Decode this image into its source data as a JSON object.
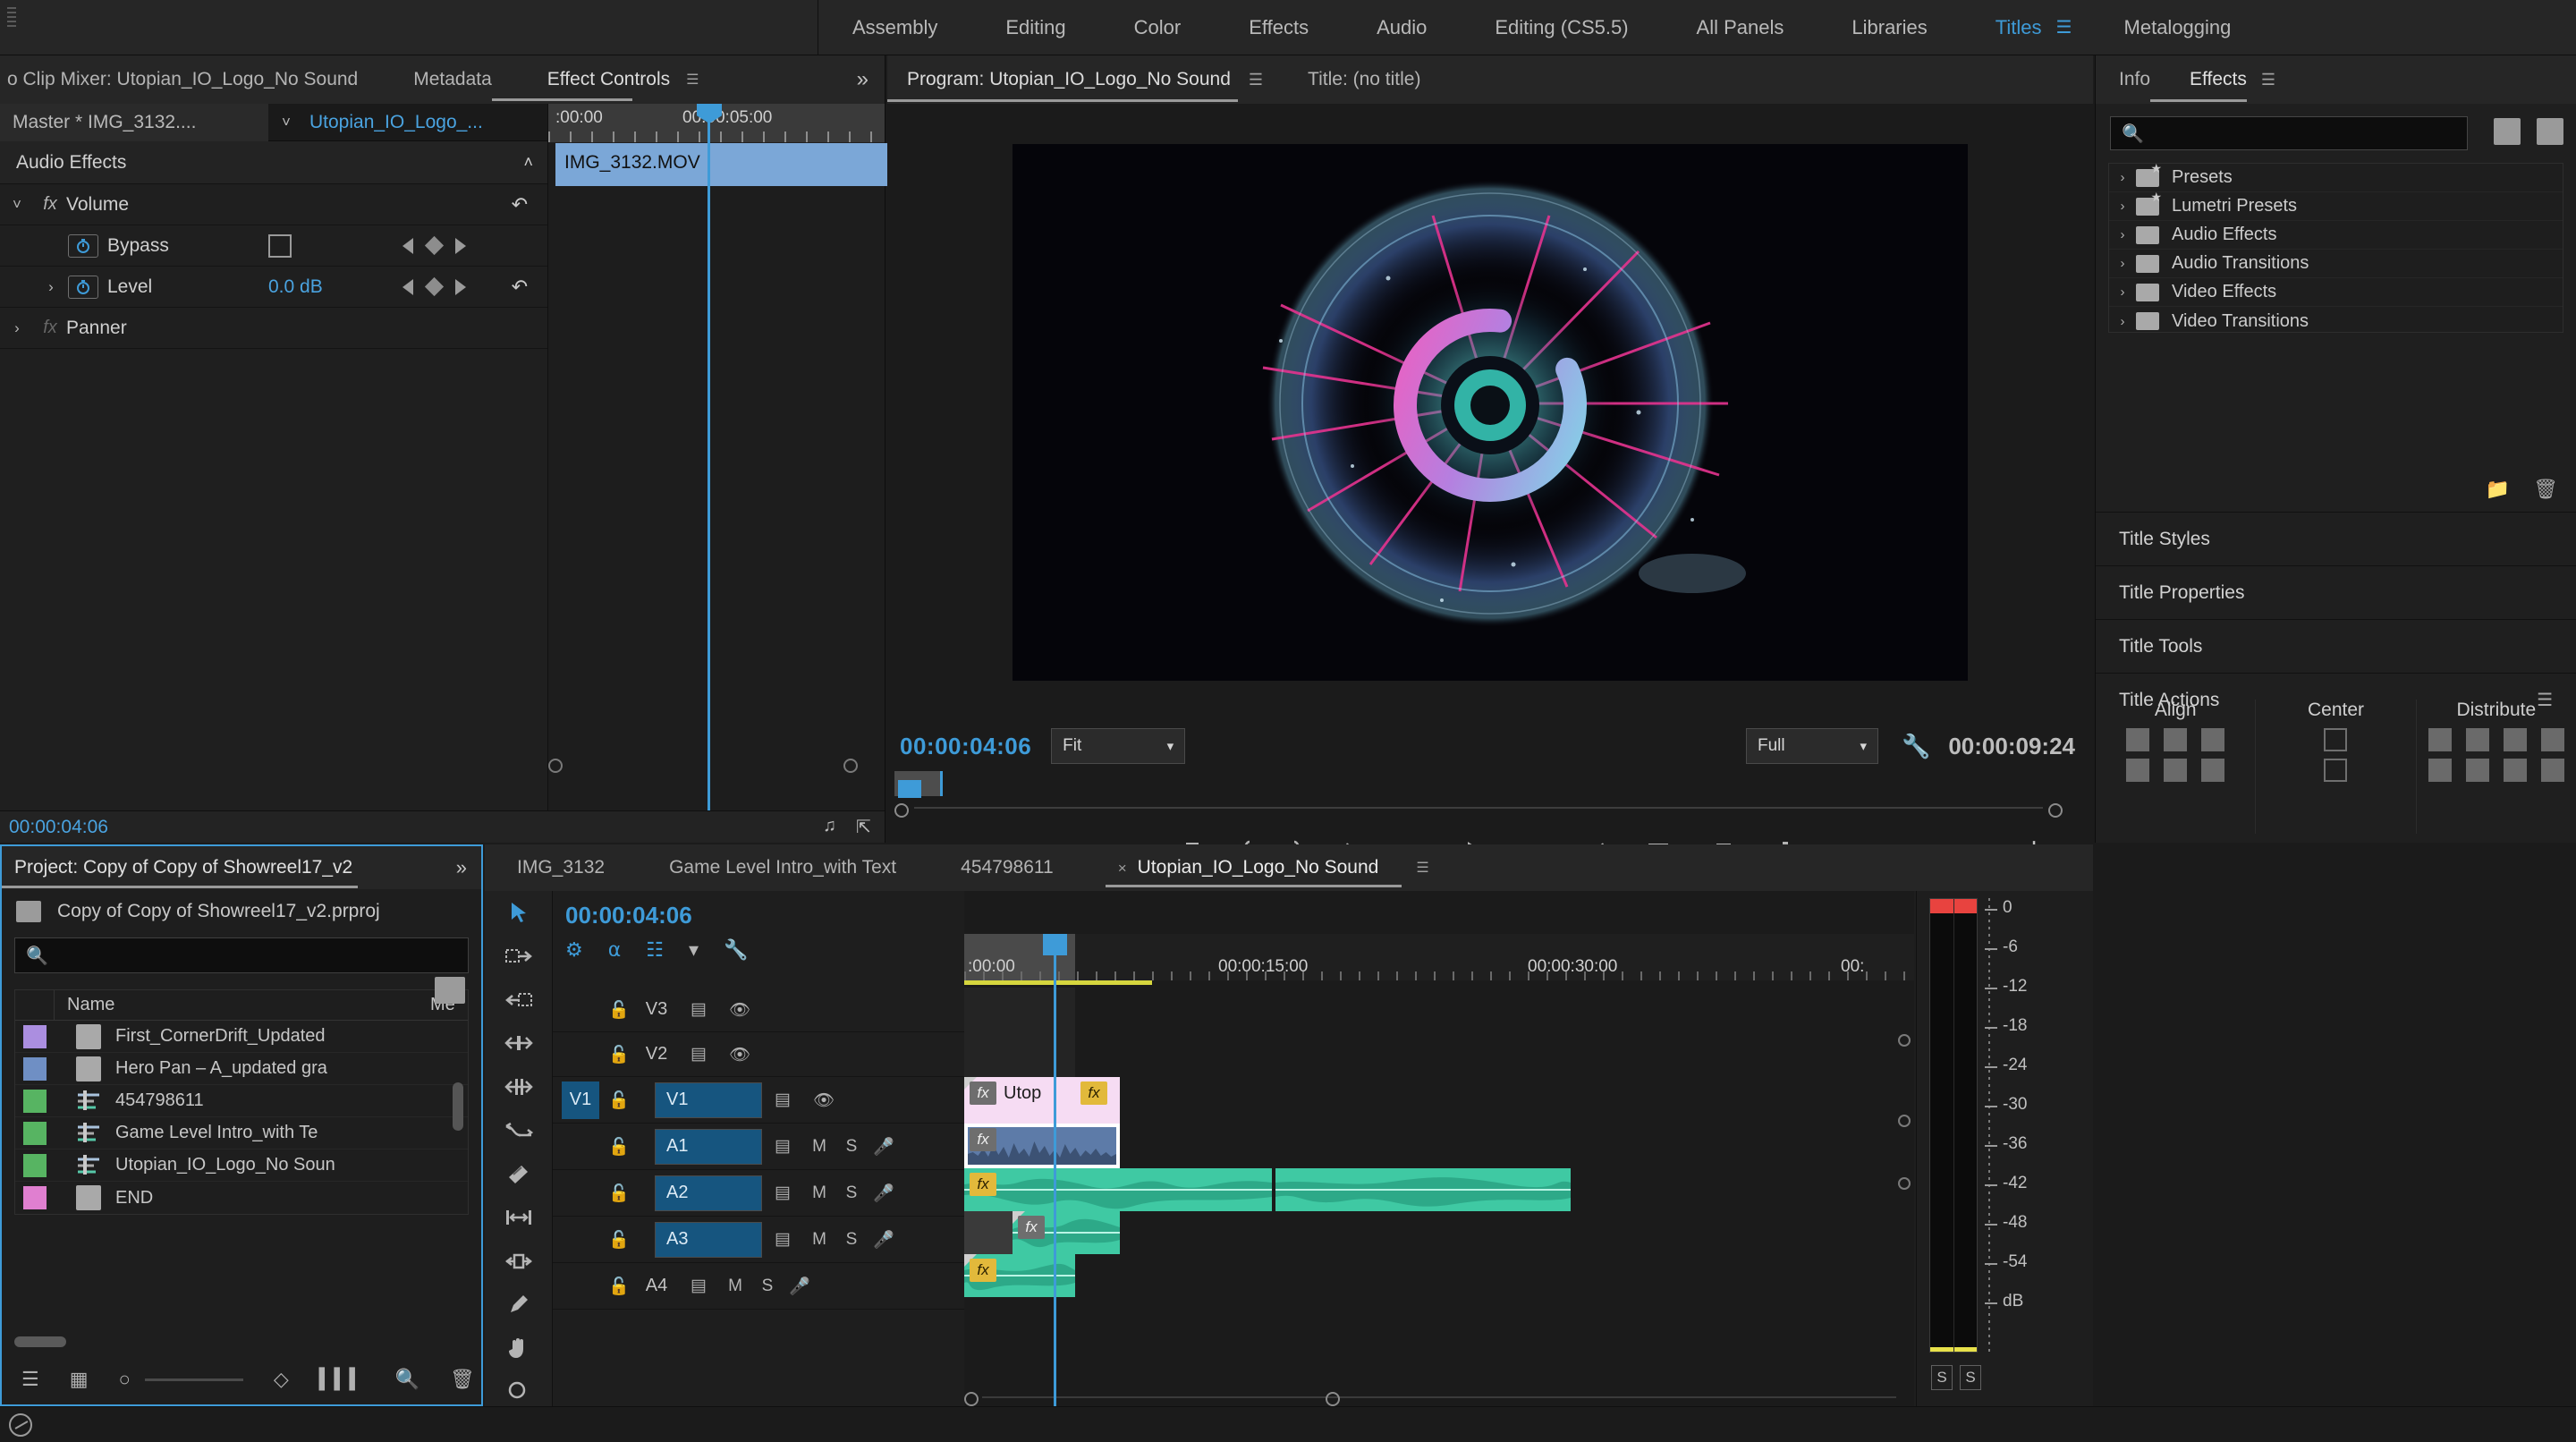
{
  "workspace": {
    "tabs": [
      {
        "label": "Assembly",
        "active": false
      },
      {
        "label": "Editing",
        "active": false
      },
      {
        "label": "Color",
        "active": false
      },
      {
        "label": "Effects",
        "active": false
      },
      {
        "label": "Audio",
        "active": false
      },
      {
        "label": "Editing (CS5.5)",
        "active": false
      },
      {
        "label": "All Panels",
        "active": false
      },
      {
        "label": "Libraries",
        "active": false
      },
      {
        "label": "Titles",
        "active": true
      },
      {
        "label": "Metalogging",
        "active": false
      }
    ]
  },
  "effect_controls": {
    "tab_clip_mixer": "o Clip Mixer: Utopian_IO_Logo_No Sound",
    "tab_metadata": "Metadata",
    "tab_effect_controls": "Effect Controls",
    "master_clip": "Master * IMG_3132....",
    "sequence_name": "Utopian_IO_Logo_...",
    "section_title": "Audio Effects",
    "properties": [
      {
        "name": "Volume",
        "type": "effect",
        "fx": "fx",
        "expanded": true,
        "has_reset": true
      },
      {
        "name": "Bypass",
        "type": "checkbox",
        "value": "",
        "checked": false,
        "has_stopwatch": true
      },
      {
        "name": "Level",
        "type": "value",
        "value": "0.0 dB",
        "has_stopwatch": true,
        "has_reset": true
      },
      {
        "name": "Panner",
        "type": "effect",
        "fx": "fx",
        "expanded": false,
        "dim": true
      }
    ],
    "ruler_labels": [
      ":00:00",
      "00:00:05:00"
    ],
    "clip_name": "IMG_3132.MOV",
    "footer_time": "00:00:04:06"
  },
  "program_monitor": {
    "title": "Program: Utopian_IO_Logo_No Sound",
    "title_tab": "Title: (no title)",
    "current_time": "00:00:04:06",
    "duration": "00:00:09:24",
    "fit_value": "Fit",
    "quality_value": "Full",
    "transport_buttons": [
      "add-marker",
      "mark-in",
      "mark-out",
      "go-to-in",
      "step-back",
      "play",
      "step-forward",
      "go-to-out",
      "lift",
      "extract",
      "export-frame"
    ]
  },
  "right_panel": {
    "tab_info": "Info",
    "tab_effects": "Effects",
    "search_placeholder": "",
    "search_value": "",
    "tree": [
      {
        "label": "Presets",
        "star": true
      },
      {
        "label": "Lumetri Presets",
        "star": true
      },
      {
        "label": "Audio Effects",
        "star": false
      },
      {
        "label": "Audio Transitions",
        "star": false
      },
      {
        "label": "Video Effects",
        "star": false
      },
      {
        "label": "Video Transitions",
        "star": false
      }
    ],
    "sections": [
      {
        "label": "Title Styles"
      },
      {
        "label": "Title Properties"
      },
      {
        "label": "Title Tools"
      },
      {
        "label": "Title Actions"
      }
    ],
    "title_actions": {
      "align_label": "Align",
      "center_label": "Center",
      "distribute_label": "Distribute"
    }
  },
  "project_panel": {
    "title": "Project: Copy of Copy of Showreel17_v2",
    "file_name": "Copy of Copy of Showreel17_v2.prproj",
    "search_value": "",
    "columns": [
      "",
      "Name",
      "Me"
    ],
    "items": [
      {
        "name": "First_CornerDrift_Updated",
        "color": "#ab8ee0",
        "icon": "unknown-media-icon"
      },
      {
        "name": "Hero Pan – A_updated gra",
        "color": "#6f8fc4",
        "icon": "unknown-media-icon"
      },
      {
        "name": "454798611",
        "color": "#57b462",
        "icon": "sequence-icon"
      },
      {
        "name": "Game Level Intro_with Te",
        "color": "#57b462",
        "icon": "sequence-icon"
      },
      {
        "name": "Utopian_IO_Logo_No Soun",
        "color": "#57b462",
        "icon": "sequence-icon"
      },
      {
        "name": "END",
        "color": "#e07fd0",
        "icon": "title-icon"
      }
    ]
  },
  "timeline": {
    "tabs": [
      {
        "label": "IMG_3132",
        "active": false,
        "closable": false
      },
      {
        "label": "Game Level Intro_with Text",
        "active": false,
        "closable": false
      },
      {
        "label": "454798611",
        "active": false,
        "closable": false
      },
      {
        "label": "Utopian_IO_Logo_No Sound",
        "active": true,
        "closable": true
      }
    ],
    "current_time": "00:00:04:06",
    "ruler_labels": [
      ":00:00",
      "00:00:15:00",
      "00:00:30:00",
      "00:"
    ],
    "tracks": [
      {
        "name": "V3",
        "type": "video",
        "selected": false,
        "targeted": false
      },
      {
        "name": "V2",
        "type": "video",
        "selected": false,
        "targeted": false
      },
      {
        "name": "V1",
        "type": "video",
        "selected": true,
        "targeted": true
      },
      {
        "name": "A1",
        "type": "audio",
        "selected": true,
        "targeted": false
      },
      {
        "name": "A2",
        "type": "audio",
        "selected": true,
        "targeted": false
      },
      {
        "name": "A3",
        "type": "audio",
        "selected": true,
        "targeted": false
      },
      {
        "name": "A4",
        "type": "audio",
        "selected": false,
        "targeted": false
      }
    ],
    "clips": [
      {
        "track": "V1",
        "label": "Utop",
        "color": "#f6dcf3",
        "fx": [
          "gray",
          "yellow"
        ]
      },
      {
        "track": "A1",
        "label": "",
        "color": "#5d7ba8",
        "fx": [
          "gray"
        ]
      },
      {
        "track": "A2",
        "label": "",
        "color": "#3fc9a3",
        "fx": [
          "yellow"
        ]
      },
      {
        "track": "A3",
        "label": "",
        "color": "#3fc9a3",
        "fx": [
          "gray"
        ]
      },
      {
        "track": "A4",
        "label": "",
        "color": "#3fc9a3",
        "fx": [
          "yellow"
        ]
      }
    ],
    "track_controls": {
      "mute": "M",
      "solo": "S"
    }
  },
  "audio_meters": {
    "scale": [
      "0",
      "-6",
      "-12",
      "-18",
      "-24",
      "-30",
      "-36",
      "-42",
      "-48",
      "-54",
      "dB"
    ],
    "solo_buttons": [
      "S",
      "S"
    ],
    "peak_color": "#e8433f",
    "floor_color": "#e8e14a"
  },
  "colors": {
    "accent_blue": "#3e9bd8",
    "panel_bg": "#1f1f1f",
    "toolbar_bg": "#262626",
    "track_select": "#16557f"
  }
}
